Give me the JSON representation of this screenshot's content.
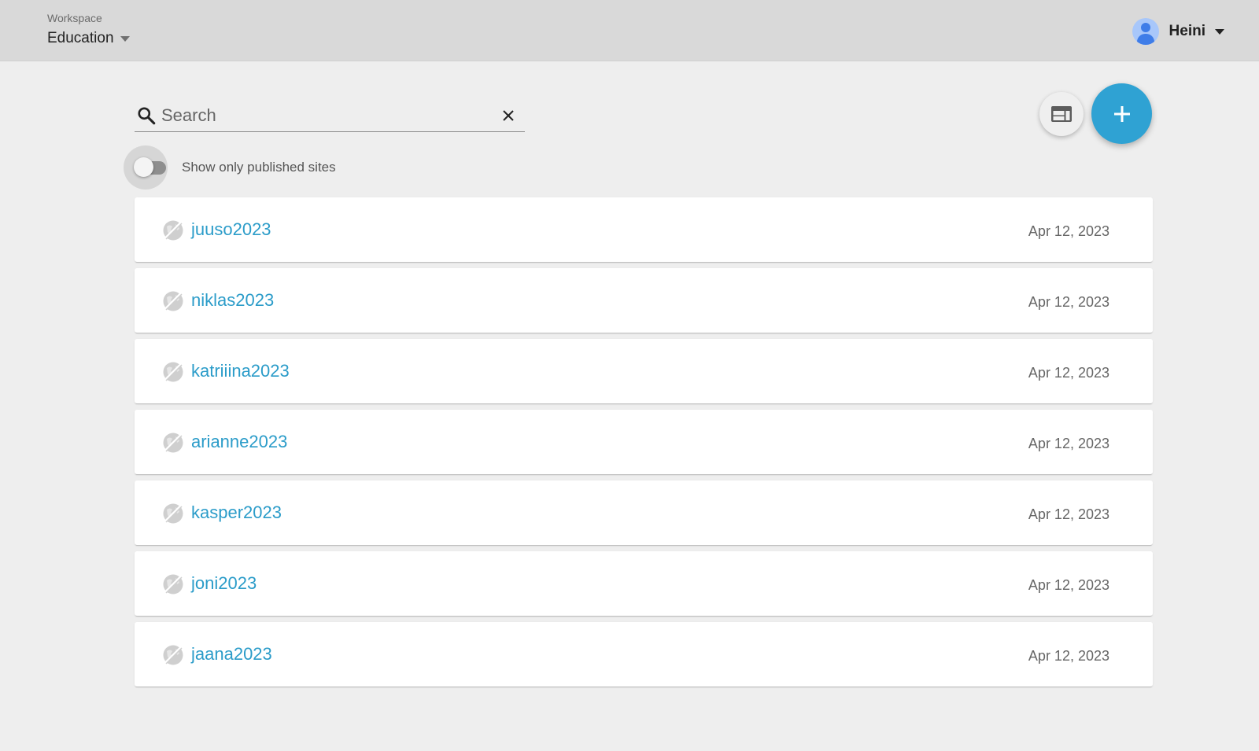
{
  "header": {
    "workspace_label": "Workspace",
    "workspace_name": "Education",
    "user_name": "Heini"
  },
  "search": {
    "placeholder": "Search",
    "value": ""
  },
  "filter": {
    "published_only_label": "Show only published sites",
    "published_only_checked": false
  },
  "actions": {
    "layout_icon": "web-layout-icon",
    "add_icon": "plus-icon"
  },
  "sites": [
    {
      "name": "juuso2023",
      "date": "Apr 12, 2023",
      "status_icon": "unpublished-globe-icon"
    },
    {
      "name": "niklas2023",
      "date": "Apr 12, 2023",
      "status_icon": "unpublished-globe-icon"
    },
    {
      "name": "katriiina2023",
      "date": "Apr 12, 2023",
      "status_icon": "unpublished-globe-icon"
    },
    {
      "name": "arianne2023",
      "date": "Apr 12, 2023",
      "status_icon": "unpublished-globe-icon"
    },
    {
      "name": "kasper2023",
      "date": "Apr 12, 2023",
      "status_icon": "unpublished-globe-icon"
    },
    {
      "name": "joni2023",
      "date": "Apr 12, 2023",
      "status_icon": "unpublished-globe-icon"
    },
    {
      "name": "jaana2023",
      "date": "Apr 12, 2023",
      "status_icon": "unpublished-globe-icon"
    }
  ],
  "colors": {
    "accent": "#2fa2d3",
    "link": "#2b9cc9",
    "topbar": "#d9d9d9",
    "background": "#eeeeee"
  }
}
